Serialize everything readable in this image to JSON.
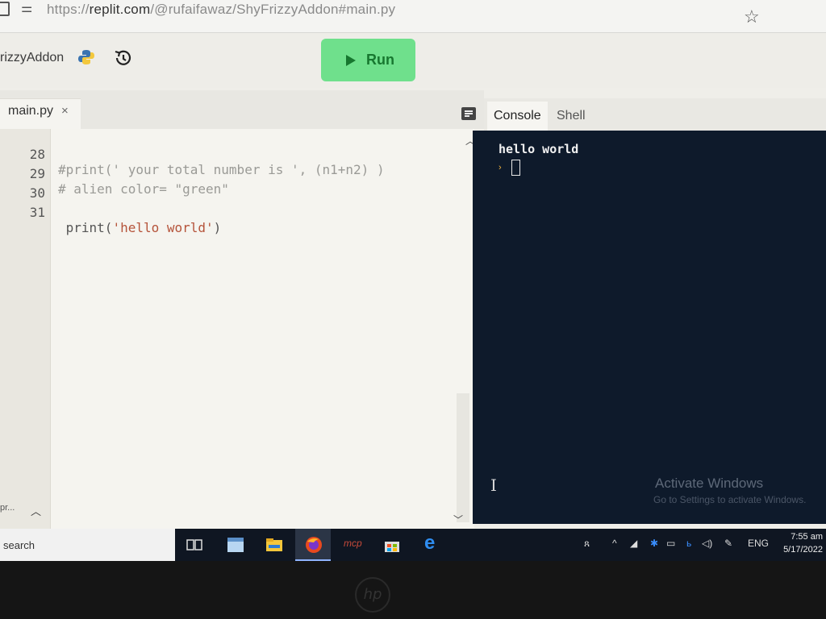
{
  "browser": {
    "url_prefix": "https://",
    "url_host": "replit.com",
    "url_path": "/@rufaifawaz/ShyFrizzyAddon#main.py"
  },
  "header": {
    "repl_name": "rizzyAddon",
    "run_label": "Run"
  },
  "editor": {
    "tab_name": "main.py",
    "tab_close": "×",
    "lines": [
      {
        "num": "28",
        "text": "#print(' your total number is ', (n1+n2) )",
        "kind": "comment"
      },
      {
        "num": "29",
        "text": "# alien color= \"green\"",
        "kind": "comment"
      },
      {
        "num": "30",
        "text": "",
        "kind": "code"
      },
      {
        "num": "31",
        "pre": " print(",
        "str": "'hello world'",
        "post": ")",
        "kind": "mixed"
      }
    ],
    "mini_label": "pr..."
  },
  "console": {
    "tabs": [
      "Console",
      "Shell"
    ],
    "output": "hello world",
    "prompt": "›"
  },
  "watermark": {
    "title": "Activate Windows",
    "subtitle": "Go to Settings to activate Windows."
  },
  "taskbar": {
    "search_text": "search",
    "lang": "ENG",
    "time": "7:55 am",
    "date": "5/17/2022",
    "icons": [
      "task-view-icon",
      "paint-icon",
      "file-explorer-icon",
      "firefox-icon",
      "mcafee-icon",
      "store-icon",
      "edge-icon"
    ]
  },
  "colors": {
    "run_button": "#6fe08c",
    "console_bg": "#0e1a2b",
    "taskbar_bg": "#0f1622"
  }
}
